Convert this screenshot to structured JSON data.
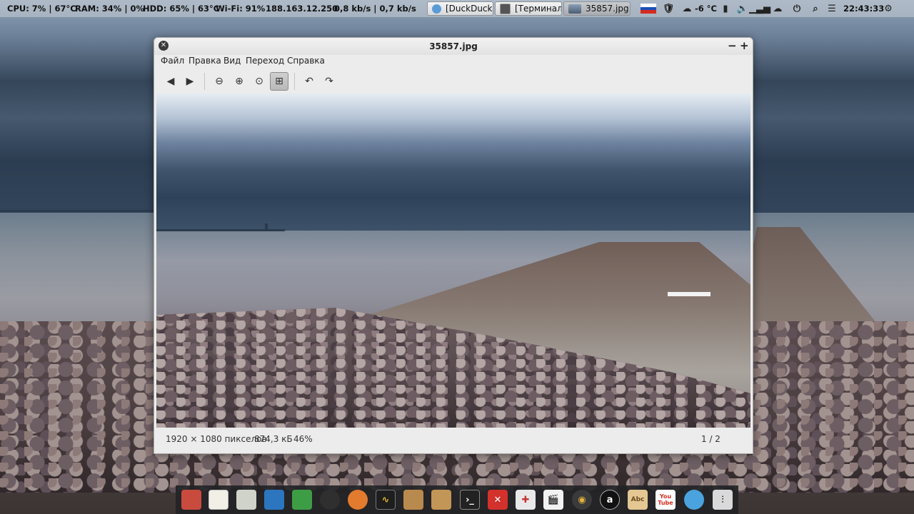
{
  "top_panel": {
    "cpu": "CPU: 7% | 67°C",
    "ram": "RAM: 34% | 0%",
    "hdd": "HDD: 65% | 63°C",
    "wifi": "Wi-Fi: 91%",
    "ip": "188.163.12.250",
    "net": "0,8 kb/s | 0,7 kb/s",
    "tasks": [
      {
        "label": "[DuckDuck..."
      },
      {
        "label": "[Терминал]"
      },
      {
        "label": "35857.jpg"
      }
    ],
    "weather": "-6 °C",
    "clock": "22:43:33"
  },
  "window": {
    "title": "35857.jpg",
    "menu": [
      "Файл",
      "Правка",
      "Вид",
      "Переход",
      "Справка"
    ],
    "status": {
      "dimensions": "1920 × 1080 пикселов",
      "size": "874,3 кБ",
      "zoom": "46%",
      "page": "1 / 2"
    }
  },
  "dock": {
    "apps": [
      "image-viewer",
      "text-editor",
      "calculator",
      "writer",
      "spreadsheet",
      "media",
      "browser",
      "system-monitor",
      "archive",
      "archive-install",
      "terminal",
      "crossover",
      "transfer",
      "video-editor",
      "audio",
      "amazon",
      "dictionary",
      "youtube",
      "network",
      "mixer"
    ],
    "amazon_label": "a",
    "youtube_label": "You Tube"
  }
}
